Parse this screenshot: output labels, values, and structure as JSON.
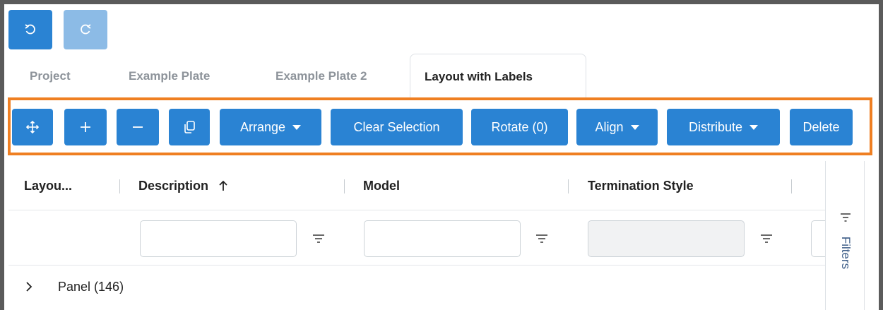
{
  "history": {
    "undo_icon": "undo-icon",
    "redo_icon": "redo-icon"
  },
  "tabs": [
    {
      "label": "Project",
      "active": false
    },
    {
      "label": "Example Plate",
      "active": false
    },
    {
      "label": "Example Plate 2",
      "active": false
    },
    {
      "label": "Layout with Labels",
      "active": true
    }
  ],
  "toolbar": {
    "move_icon": "move-icon",
    "add_icon": "plus-icon",
    "remove_icon": "minus-icon",
    "copy_icon": "copy-icon",
    "arrange_label": "Arrange",
    "clear_selection_label": "Clear Selection",
    "rotate_label": "Rotate (0)",
    "align_label": "Align",
    "distribute_label": "Distribute",
    "delete_label": "Delete",
    "highlight_color": "#ef7f22",
    "button_color": "#2a83d3"
  },
  "grid": {
    "columns": [
      {
        "label": "Layou..."
      },
      {
        "label": "Description",
        "sort": "ascending"
      },
      {
        "label": "Model"
      },
      {
        "label": "Termination Style"
      }
    ],
    "filters_label": "Filters",
    "rows": [
      {
        "label": "Panel (146)",
        "expanded": false
      }
    ]
  }
}
